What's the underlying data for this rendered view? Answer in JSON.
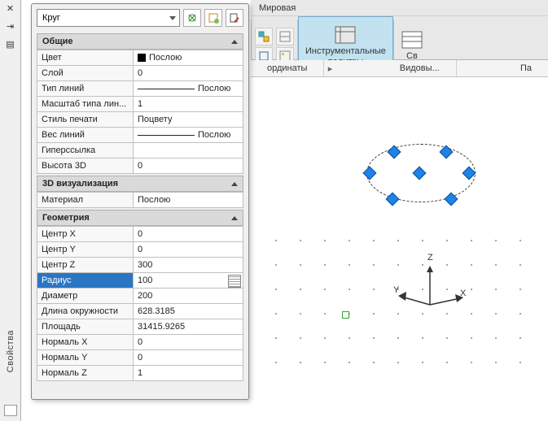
{
  "topbar": {
    "world_label": "Мировая"
  },
  "ribbon": {
    "tool_palettes": "Инструментальные\nпалитры",
    "props_partial": "Св"
  },
  "midbar": {
    "coords": "ординаты",
    "views": "Видовы...",
    "right": "Па"
  },
  "left_strip": {
    "title": "Свойства"
  },
  "properties": {
    "type_selector": "Круг",
    "sections": {
      "general": {
        "title": "Общие",
        "rows": {
          "color": {
            "key": "Цвет",
            "val": "Послою"
          },
          "layer": {
            "key": "Слой",
            "val": "0"
          },
          "linetype": {
            "key": "Тип линий",
            "val": "Послою"
          },
          "ltscale": {
            "key": "Масштаб типа лин...",
            "val": "1"
          },
          "plotstyle": {
            "key": "Стиль печати",
            "val": "Поцвету"
          },
          "lineweight": {
            "key": "Вес линий",
            "val": "Послою"
          },
          "hyperlink": {
            "key": "Гиперссылка",
            "val": ""
          },
          "height3d": {
            "key": "Высота 3D",
            "val": "0"
          }
        }
      },
      "viz3d": {
        "title": "3D визуализация",
        "rows": {
          "material": {
            "key": "Материал",
            "val": "Послою"
          }
        }
      },
      "geometry": {
        "title": "Геометрия",
        "rows": {
          "cx": {
            "key": "Центр X",
            "val": "0"
          },
          "cy": {
            "key": "Центр Y",
            "val": "0"
          },
          "cz": {
            "key": "Центр Z",
            "val": "300"
          },
          "radius": {
            "key": "Радиус",
            "val": "100"
          },
          "diam": {
            "key": "Диаметр",
            "val": "200"
          },
          "circ": {
            "key": "Длина окружности",
            "val": "628.3185"
          },
          "area": {
            "key": "Площадь",
            "val": "31415.9265"
          },
          "nx": {
            "key": "Нормаль X",
            "val": "0"
          },
          "ny": {
            "key": "Нормаль Y",
            "val": "0"
          },
          "nz": {
            "key": "Нормаль Z",
            "val": "1"
          }
        }
      }
    }
  },
  "ucs": {
    "x": "X",
    "y": "Y",
    "z": "Z"
  }
}
